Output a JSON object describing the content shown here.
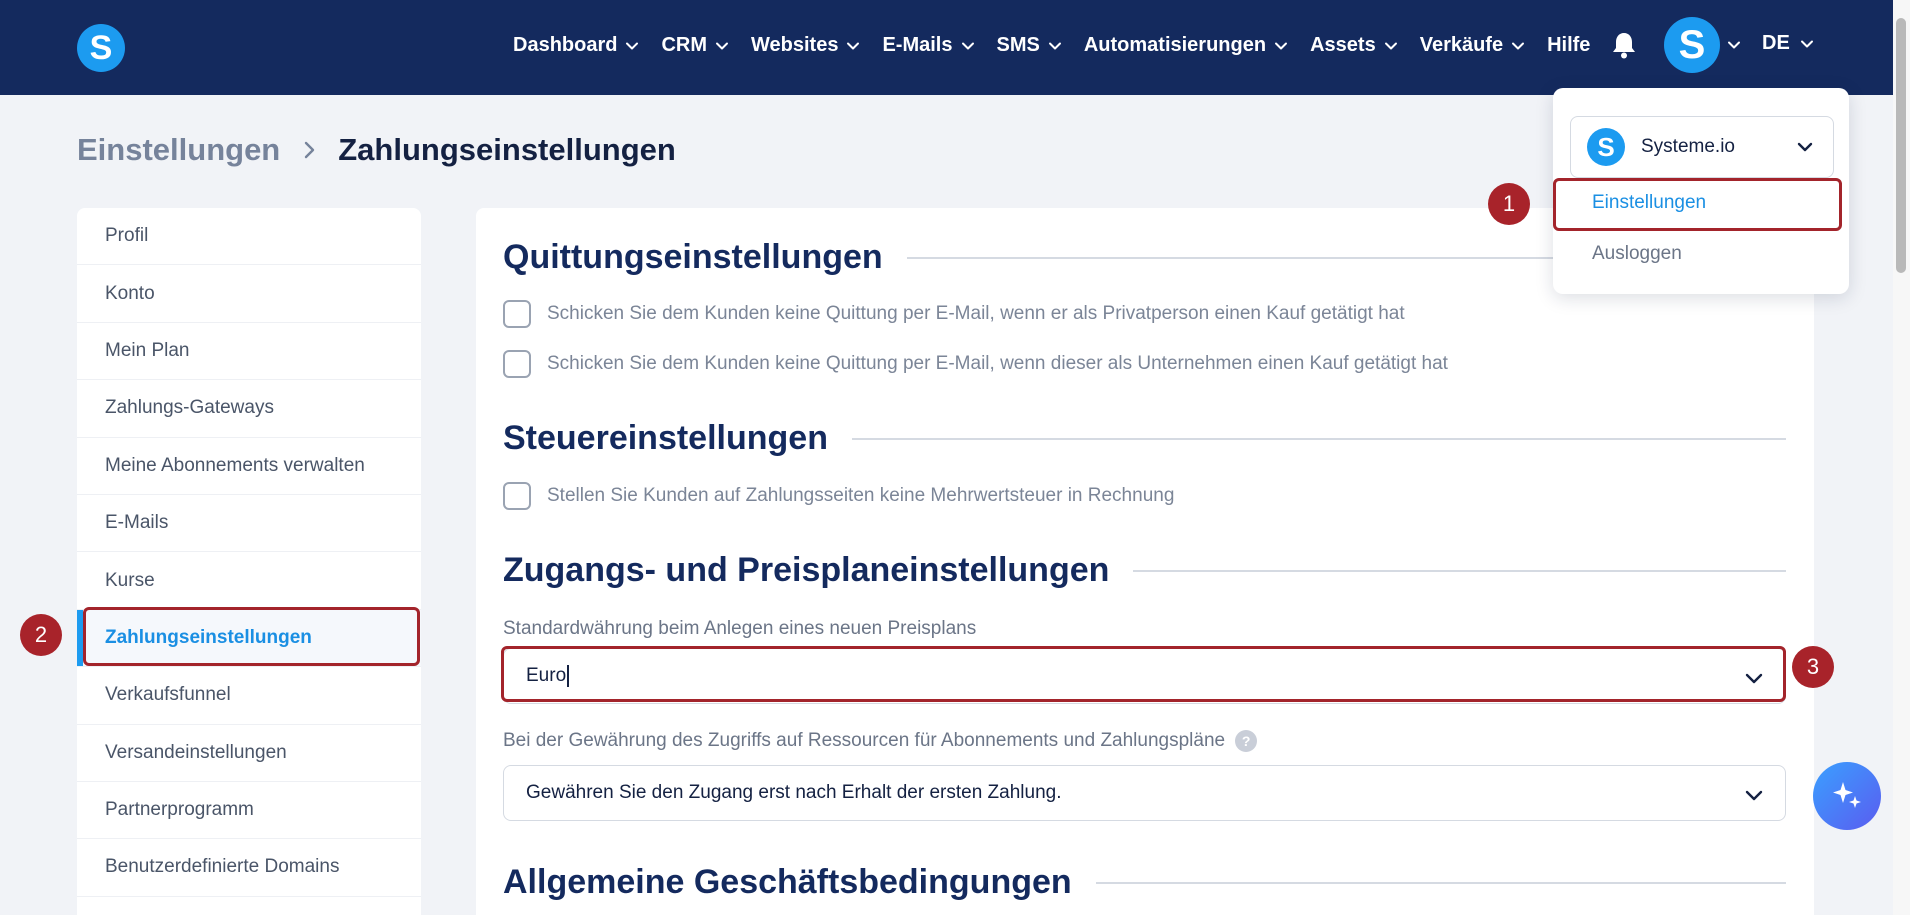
{
  "brand": {
    "logo_letter": "S"
  },
  "nav": {
    "items": [
      {
        "label": "Dashboard",
        "has_dropdown": true
      },
      {
        "label": "CRM",
        "has_dropdown": true
      },
      {
        "label": "Websites",
        "has_dropdown": true
      },
      {
        "label": "E-Mails",
        "has_dropdown": true
      },
      {
        "label": "SMS",
        "has_dropdown": true
      },
      {
        "label": "Automatisierungen",
        "has_dropdown": true
      },
      {
        "label": "Assets",
        "has_dropdown": true
      },
      {
        "label": "Verkäufe",
        "has_dropdown": true
      },
      {
        "label": "Hilfe",
        "has_dropdown": false
      }
    ],
    "avatar_letter": "S",
    "language": "DE",
    "icons": {
      "notifications": "bell-icon"
    }
  },
  "breadcrumb": {
    "parent": "Einstellungen",
    "current": "Zahlungseinstellungen"
  },
  "sidebar": {
    "items": [
      {
        "label": "Profil"
      },
      {
        "label": "Konto"
      },
      {
        "label": "Mein Plan"
      },
      {
        "label": "Zahlungs-Gateways"
      },
      {
        "label": "Meine Abonnements verwalten"
      },
      {
        "label": "E-Mails"
      },
      {
        "label": "Kurse"
      },
      {
        "label": "Zahlungseinstellungen",
        "active": true
      },
      {
        "label": "Verkaufsfunnel"
      },
      {
        "label": "Versandeinstellungen"
      },
      {
        "label": "Partnerprogramm"
      },
      {
        "label": "Benutzerdefinierte Domains"
      }
    ]
  },
  "main": {
    "receipts": {
      "title": "Quittungseinstellungen",
      "options": [
        {
          "label": "Schicken Sie dem Kunden keine Quittung per E-Mail, wenn er als Privatperson einen Kauf getätigt hat",
          "checked": false
        },
        {
          "label": "Schicken Sie dem Kunden keine Quittung per E-Mail, wenn dieser als Unternehmen einen Kauf getätigt hat",
          "checked": false
        }
      ]
    },
    "tax": {
      "title": "Steuereinstellungen",
      "options": [
        {
          "label": "Stellen Sie Kunden auf Zahlungsseiten keine Mehrwertsteuer in Rechnung",
          "checked": false
        }
      ]
    },
    "access": {
      "title": "Zugangs- und Preisplaneinstellungen",
      "currency_label": "Standardwährung beim Anlegen eines neuen Preisplans",
      "currency_value": "Euro",
      "grant_label": "Bei der Gewährung des Zugriffs auf Ressourcen für Abonnements und Zahlungspläne",
      "help_glyph": "?",
      "grant_value": "Gewähren Sie den Zugang erst nach Erhalt der ersten Zahlung."
    },
    "terms": {
      "title": "Allgemeine Geschäftsbedingungen"
    }
  },
  "account_menu": {
    "account_name": "Systeme.io",
    "logo_letter": "S",
    "items": [
      {
        "label": "Einstellungen",
        "highlighted": true
      },
      {
        "label": "Ausloggen"
      }
    ]
  },
  "annotations": {
    "badges": [
      "1",
      "2",
      "3"
    ],
    "color": "#a8232a"
  },
  "theme": {
    "nav_bg": "#142a5e",
    "accent": "#1c9bf0",
    "heading": "#142a5e"
  }
}
